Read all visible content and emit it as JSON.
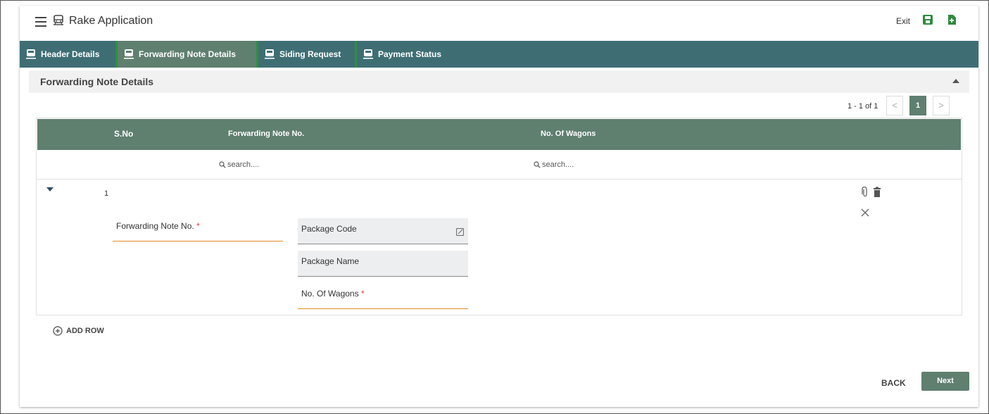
{
  "app": {
    "title": "Rake Application"
  },
  "toolbar": {
    "exit_label": "Exit",
    "save_icon": "save-icon",
    "add_doc_icon": "add-document-icon"
  },
  "tabs": [
    {
      "label": "Header Details",
      "icon": "train-icon",
      "active": false
    },
    {
      "label": "Forwarding Note Details",
      "icon": "train-icon",
      "active": true
    },
    {
      "label": "Siding Request",
      "icon": "train-icon",
      "active": false
    },
    {
      "label": "Payment Status",
      "icon": "train-icon",
      "active": false
    }
  ],
  "section": {
    "title": "Forwarding Note Details"
  },
  "pagination": {
    "summary": "1 - 1 of 1",
    "current_page": "1",
    "prev": "<",
    "next": ">"
  },
  "grid": {
    "columns": [
      "S.No",
      "Forwarding Note No.",
      "No. Of Wagons"
    ],
    "search_placeholders": {
      "forwarding_note": "search....",
      "wagons": "search...."
    },
    "rows": [
      {
        "sno": "1"
      }
    ]
  },
  "form": {
    "forwarding_note_label": "Forwarding Note No.",
    "package_code_label": "Package Code",
    "package_name_label": "Package Name",
    "wagons_label": "No. Of Wagons",
    "required_mark": "*"
  },
  "actions": {
    "add_row_label": "ADD ROW",
    "back_label": "BACK",
    "next_label": "Next"
  },
  "colors": {
    "tab_bar": "#3e6e74",
    "accent": "#5f7f6f",
    "tab_separator": "#2f8f3a",
    "required": "#e03c31",
    "underline": "#e08a2a"
  }
}
